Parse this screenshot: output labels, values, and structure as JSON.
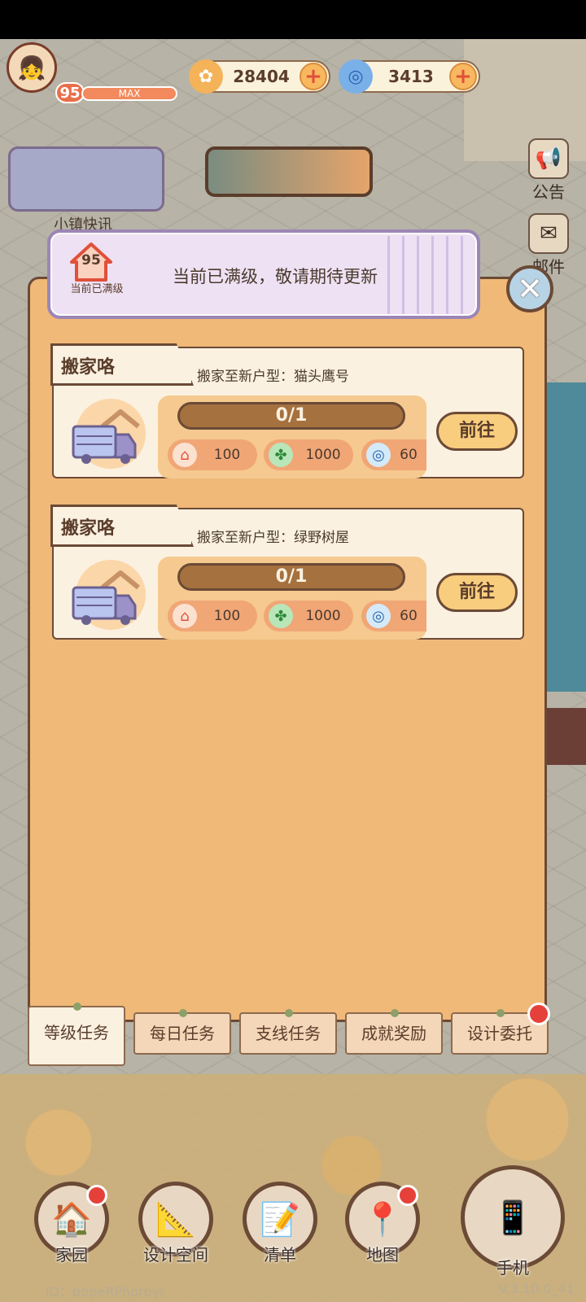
{
  "hud": {
    "level": "95",
    "level_bar_label": "MAX",
    "gold": "28404",
    "gems": "3413"
  },
  "left_widgets": {
    "news_label": "小镇快讯"
  },
  "right_widgets": {
    "announcement": "公告",
    "mail": "邮件"
  },
  "max_banner": {
    "house_level": "95",
    "sub_label": "当前已满级",
    "message": "当前已满级，敬请期待更新"
  },
  "tasks": [
    {
      "tab": "搬家咯",
      "desc": "搬家至新户型：猫头鹰号",
      "progress": "0/1",
      "rewards": [
        "100",
        "1000",
        "60"
      ],
      "button": "前往"
    },
    {
      "tab": "搬家咯",
      "desc": "搬家至新户型：绿野树屋",
      "progress": "0/1",
      "rewards": [
        "100",
        "1000",
        "60"
      ],
      "button": "前往"
    }
  ],
  "tabs": [
    "等级任务",
    "每日任务",
    "支线任务",
    "成就奖励",
    "设计委托"
  ],
  "active_tab": "等级任务",
  "nav": [
    "家园",
    "设计空间",
    "清单",
    "地图",
    "手机"
  ],
  "footer": {
    "id": "ID：bbpeRPhorbyt",
    "version": "V.3.10.0_41"
  },
  "colors": {
    "panel": "#f0b977",
    "card": "#fbf1e1",
    "border": "#6b4a36",
    "accent_red": "#e5413a"
  }
}
